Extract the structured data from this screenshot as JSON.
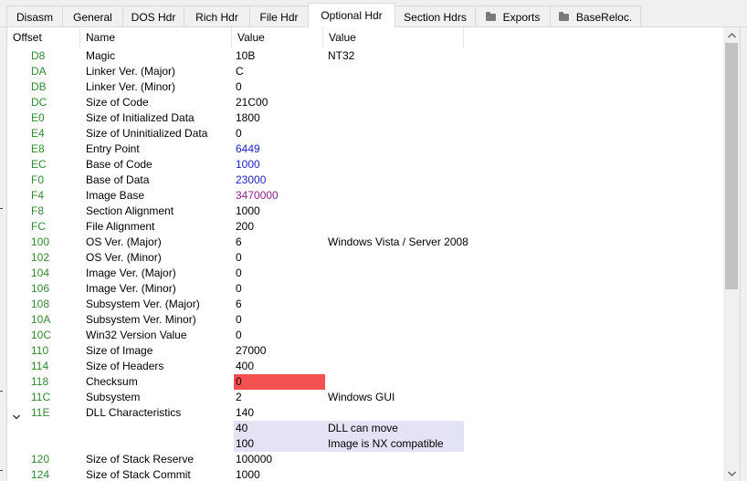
{
  "tabs": [
    {
      "label": "Disasm",
      "active": false,
      "folder": false
    },
    {
      "label": "General",
      "active": false,
      "folder": false
    },
    {
      "label": "DOS Hdr",
      "active": false,
      "folder": false
    },
    {
      "label": "Rich Hdr",
      "active": false,
      "folder": false
    },
    {
      "label": "File Hdr",
      "active": false,
      "folder": false
    },
    {
      "label": "Optional Hdr",
      "active": true,
      "folder": false
    },
    {
      "label": "Section Hdrs",
      "active": false,
      "folder": false
    },
    {
      "label": "Exports",
      "active": false,
      "folder": true
    },
    {
      "label": "BaseReloc.",
      "active": false,
      "folder": true
    }
  ],
  "columns": {
    "offset": "Offset",
    "name": "Name",
    "value": "Value",
    "value2": "Value"
  },
  "rows": [
    {
      "offset": "D8",
      "name": "Magic",
      "value": "10B",
      "desc": "NT32",
      "style": ""
    },
    {
      "offset": "DA",
      "name": "Linker Ver. (Major)",
      "value": "C",
      "desc": "",
      "style": ""
    },
    {
      "offset": "DB",
      "name": "Linker Ver. (Minor)",
      "value": "0",
      "desc": "",
      "style": ""
    },
    {
      "offset": "DC",
      "name": "Size of Code",
      "value": "21C00",
      "desc": "",
      "style": ""
    },
    {
      "offset": "E0",
      "name": "Size of Initialized Data",
      "value": "1800",
      "desc": "",
      "style": ""
    },
    {
      "offset": "E4",
      "name": "Size of Uninitialized Data",
      "value": "0",
      "desc": "",
      "style": ""
    },
    {
      "offset": "E8",
      "name": "Entry Point",
      "value": "6449",
      "desc": "",
      "style": "blue"
    },
    {
      "offset": "EC",
      "name": "Base of Code",
      "value": "1000",
      "desc": "",
      "style": "blue"
    },
    {
      "offset": "F0",
      "name": "Base of Data",
      "value": "23000",
      "desc": "",
      "style": "blue"
    },
    {
      "offset": "F4",
      "name": "Image Base",
      "value": "3470000",
      "desc": "",
      "style": "purple"
    },
    {
      "offset": "F8",
      "name": "Section Alignment",
      "value": "1000",
      "desc": "",
      "style": ""
    },
    {
      "offset": "FC",
      "name": "File Alignment",
      "value": "200",
      "desc": "",
      "style": ""
    },
    {
      "offset": "100",
      "name": "OS Ver. (Major)",
      "value": "6",
      "desc": "Windows Vista / Server 2008",
      "style": ""
    },
    {
      "offset": "102",
      "name": "OS Ver. (Minor)",
      "value": "0",
      "desc": "",
      "style": ""
    },
    {
      "offset": "104",
      "name": "Image Ver. (Major)",
      "value": "0",
      "desc": "",
      "style": ""
    },
    {
      "offset": "106",
      "name": "Image Ver. (Minor)",
      "value": "0",
      "desc": "",
      "style": ""
    },
    {
      "offset": "108",
      "name": "Subsystem Ver. (Major)",
      "value": "6",
      "desc": "",
      "style": ""
    },
    {
      "offset": "10A",
      "name": "Subsystem Ver. Minor)",
      "value": "0",
      "desc": "",
      "style": ""
    },
    {
      "offset": "10C",
      "name": "Win32 Version Value",
      "value": "0",
      "desc": "",
      "style": ""
    },
    {
      "offset": "110",
      "name": "Size of Image",
      "value": "27000",
      "desc": "",
      "style": ""
    },
    {
      "offset": "114",
      "name": "Size of Headers",
      "value": "400",
      "desc": "",
      "style": ""
    },
    {
      "offset": "118",
      "name": "Checksum",
      "value": "0",
      "desc": "",
      "style": "bad"
    },
    {
      "offset": "11C",
      "name": "Subsystem",
      "value": "2",
      "desc": "Windows GUI",
      "style": ""
    },
    {
      "offset": "11E",
      "name": "DLL Characteristics",
      "value": "140",
      "desc": "",
      "style": "expanded"
    },
    {
      "offset": "",
      "name": "",
      "value": "40",
      "desc": "DLL can move",
      "style": "sub"
    },
    {
      "offset": "",
      "name": "",
      "value": "100",
      "desc": "Image is NX compatible",
      "style": "sub"
    },
    {
      "offset": "120",
      "name": "Size of Stack Reserve",
      "value": "100000",
      "desc": "",
      "style": ""
    },
    {
      "offset": "124",
      "name": "Size of Stack Commit",
      "value": "1000",
      "desc": "",
      "style": ""
    }
  ],
  "colors": {
    "offset": "#2f8a2f",
    "rva": "#1d24c9",
    "va": "#8c2290",
    "bad": "#f65151",
    "sub": "#e3e3f5"
  },
  "icons": {
    "folder": "folder-icon",
    "expand": "chevron-down-icon",
    "scroll_up": "scroll-up-arrow-icon",
    "scroll_down": "scroll-down-arrow-icon"
  }
}
